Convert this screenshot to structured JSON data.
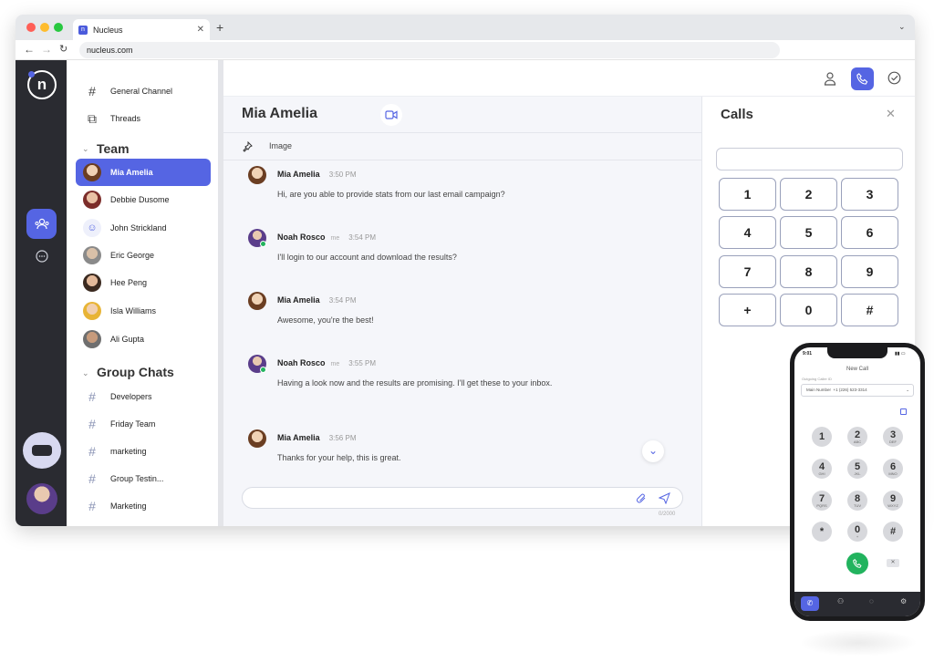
{
  "browser": {
    "tab_title": "Nucleus",
    "url": "nucleus.com",
    "tab_icon": "nucleus-logo-icon"
  },
  "sidebar": {
    "top_items": [
      {
        "label": "General Channel",
        "icon": "hash-icon"
      },
      {
        "label": "Threads",
        "icon": "threads-icon"
      }
    ],
    "team_title": "Team",
    "team": [
      {
        "label": "Mia Amelia",
        "active": true
      },
      {
        "label": "Debbie Dusome"
      },
      {
        "label": "John Strickland"
      },
      {
        "label": "Eric George"
      },
      {
        "label": "Hee Peng"
      },
      {
        "label": "Isla Williams"
      },
      {
        "label": "Ali Gupta"
      }
    ],
    "group_title": "Group Chats",
    "groups": [
      {
        "label": "Developers"
      },
      {
        "label": "Friday Team"
      },
      {
        "label": "marketing"
      },
      {
        "label": "Group Testin..."
      },
      {
        "label": "Marketing"
      }
    ]
  },
  "chat": {
    "title": "Mia Amelia",
    "pinned_label": "Image",
    "messages": [
      {
        "name": "Mia Amelia",
        "me": "",
        "time": "3:50 PM",
        "text": "Hi, are you able to provide stats from our last email campaign?"
      },
      {
        "name": "Noah Rosco",
        "me": "me",
        "time": "3:54 PM",
        "text": "I'll login to our account and download the results?"
      },
      {
        "name": "Mia Amelia",
        "me": "",
        "time": "3:54 PM",
        "text": "Awesome, you're the best!"
      },
      {
        "name": "Noah Rosco",
        "me": "me",
        "time": "3:55 PM",
        "text": "Having a look now and the results are promising. I'll get these to your inbox."
      },
      {
        "name": "Mia Amelia",
        "me": "",
        "time": "3:56 PM",
        "text": "Thanks for your help, this is great."
      }
    ],
    "composer_placeholder": "",
    "char_count": "0/2000"
  },
  "calls": {
    "title": "Calls",
    "input_value": "",
    "keys": [
      "1",
      "2",
      "3",
      "4",
      "5",
      "6",
      "7",
      "8",
      "9",
      "+",
      "0",
      "#"
    ]
  },
  "phone": {
    "status_time": "9:01",
    "title": "New Call",
    "caller_label": "Outgoing Caller ID",
    "caller_line": "Main Number",
    "caller_number": "+1 (226) 523-3314",
    "keys": [
      {
        "d": "1",
        "l": ""
      },
      {
        "d": "2",
        "l": "ABC"
      },
      {
        "d": "3",
        "l": "DEF"
      },
      {
        "d": "4",
        "l": "GHI"
      },
      {
        "d": "5",
        "l": "JKL"
      },
      {
        "d": "6",
        "l": "MNO"
      },
      {
        "d": "7",
        "l": "PQRS"
      },
      {
        "d": "8",
        "l": "TUV"
      },
      {
        "d": "9",
        "l": "WXYZ"
      },
      {
        "d": "*",
        "l": ""
      },
      {
        "d": "0",
        "l": "+"
      },
      {
        "d": "#",
        "l": ""
      }
    ]
  },
  "colors": {
    "accent": "#5565e3",
    "rail": "#2a2b31",
    "call_green": "#22b35e"
  }
}
